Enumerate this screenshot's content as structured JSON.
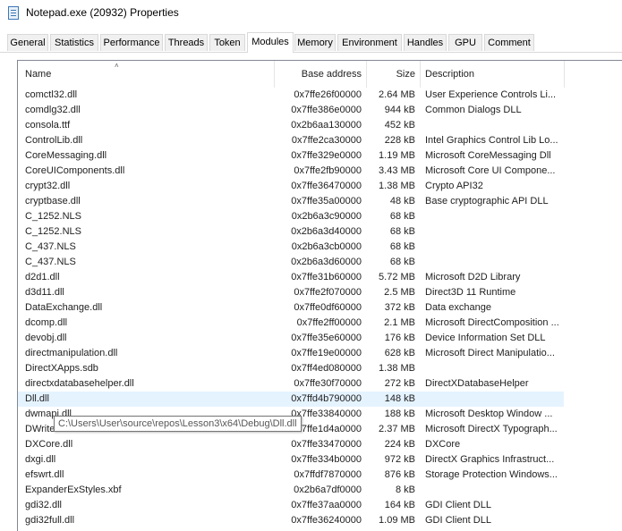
{
  "window": {
    "title": "Notepad.exe (20932) Properties",
    "icon": "notepad-app-icon"
  },
  "tabs": [
    {
      "label": "General",
      "active": false
    },
    {
      "label": "Statistics",
      "active": false
    },
    {
      "label": "Performance",
      "active": false
    },
    {
      "label": "Threads",
      "active": false
    },
    {
      "label": "Token",
      "active": false
    },
    {
      "label": "Modules",
      "active": true
    },
    {
      "label": "Memory",
      "active": false
    },
    {
      "label": "Environment",
      "active": false
    },
    {
      "label": "Handles",
      "active": false
    },
    {
      "label": "GPU",
      "active": false
    },
    {
      "label": "Comment",
      "active": false
    }
  ],
  "columns": {
    "name": "Name",
    "base": "Base address",
    "size": "Size",
    "desc": "Description",
    "sorted_by": "name",
    "sort_icon": "sort-ascending-icon"
  },
  "rows": [
    {
      "name": "comctl32.dll",
      "base": "0x7ffe26f00000",
      "size": "2.64 MB",
      "desc": "User Experience Controls Li..."
    },
    {
      "name": "comdlg32.dll",
      "base": "0x7ffe386e0000",
      "size": "944 kB",
      "desc": "Common Dialogs DLL"
    },
    {
      "name": "consola.ttf",
      "base": "0x2b6aa130000",
      "size": "452 kB",
      "desc": ""
    },
    {
      "name": "ControlLib.dll",
      "base": "0x7ffe2ca30000",
      "size": "228 kB",
      "desc": "Intel Graphics Control Lib Lo..."
    },
    {
      "name": "CoreMessaging.dll",
      "base": "0x7ffe329e0000",
      "size": "1.19 MB",
      "desc": "Microsoft CoreMessaging Dll"
    },
    {
      "name": "CoreUIComponents.dll",
      "base": "0x7ffe2fb90000",
      "size": "3.43 MB",
      "desc": "Microsoft Core UI Compone..."
    },
    {
      "name": "crypt32.dll",
      "base": "0x7ffe36470000",
      "size": "1.38 MB",
      "desc": "Crypto API32"
    },
    {
      "name": "cryptbase.dll",
      "base": "0x7ffe35a00000",
      "size": "48 kB",
      "desc": "Base cryptographic API DLL"
    },
    {
      "name": "C_1252.NLS",
      "base": "0x2b6a3c90000",
      "size": "68 kB",
      "desc": ""
    },
    {
      "name": "C_1252.NLS",
      "base": "0x2b6a3d40000",
      "size": "68 kB",
      "desc": ""
    },
    {
      "name": "C_437.NLS",
      "base": "0x2b6a3cb0000",
      "size": "68 kB",
      "desc": ""
    },
    {
      "name": "C_437.NLS",
      "base": "0x2b6a3d60000",
      "size": "68 kB",
      "desc": ""
    },
    {
      "name": "d2d1.dll",
      "base": "0x7ffe31b60000",
      "size": "5.72 MB",
      "desc": "Microsoft D2D Library"
    },
    {
      "name": "d3d11.dll",
      "base": "0x7ffe2f070000",
      "size": "2.5 MB",
      "desc": "Direct3D 11 Runtime"
    },
    {
      "name": "DataExchange.dll",
      "base": "0x7ffe0df60000",
      "size": "372 kB",
      "desc": "Data exchange"
    },
    {
      "name": "dcomp.dll",
      "base": "0x7ffe2ff00000",
      "size": "2.1 MB",
      "desc": "Microsoft DirectComposition ..."
    },
    {
      "name": "devobj.dll",
      "base": "0x7ffe35e60000",
      "size": "176 kB",
      "desc": "Device Information Set DLL"
    },
    {
      "name": "directmanipulation.dll",
      "base": "0x7ffe19e00000",
      "size": "628 kB",
      "desc": "Microsoft Direct Manipulatio..."
    },
    {
      "name": "DirectXApps.sdb",
      "base": "0x7ff4ed080000",
      "size": "1.38 MB",
      "desc": ""
    },
    {
      "name": "directxdatabasehelper.dll",
      "base": "0x7ffe30f70000",
      "size": "272 kB",
      "desc": "DirectXDatabaseHelper"
    },
    {
      "name": "Dll.dll",
      "base": "0x7ffd4b790000",
      "size": "148 kB",
      "desc": "",
      "hover": true
    },
    {
      "name": "dwmapi.dll",
      "base": "0x7ffe33840000",
      "size": "188 kB",
      "desc": "Microsoft Desktop Window ..."
    },
    {
      "name": "DWrite.dll",
      "base": "0x7ffe1d4a0000",
      "size": "2.37 MB",
      "desc": "Microsoft DirectX Typograph..."
    },
    {
      "name": "DXCore.dll",
      "base": "0x7ffe33470000",
      "size": "224 kB",
      "desc": "DXCore"
    },
    {
      "name": "dxgi.dll",
      "base": "0x7ffe334b0000",
      "size": "972 kB",
      "desc": "DirectX Graphics Infrastruct..."
    },
    {
      "name": "efswrt.dll",
      "base": "0x7ffdf7870000",
      "size": "876 kB",
      "desc": "Storage Protection Windows..."
    },
    {
      "name": "ExpanderExStyles.xbf",
      "base": "0x2b6a7df0000",
      "size": "8 kB",
      "desc": ""
    },
    {
      "name": "gdi32.dll",
      "base": "0x7ffe37aa0000",
      "size": "164 kB",
      "desc": "GDI Client DLL"
    },
    {
      "name": "gdi32full.dll",
      "base": "0x7ffe36240000",
      "size": "1.09 MB",
      "desc": "GDI Client DLL"
    }
  ],
  "tooltip": {
    "text": "C:\\Users\\User\\source\\repos\\Lesson3\\x64\\Debug\\Dll.dll"
  },
  "colors": {
    "hover_row": "#e5f3ff",
    "tab_border": "#d9d9d9",
    "tab_bg": "#f0f0f0"
  }
}
